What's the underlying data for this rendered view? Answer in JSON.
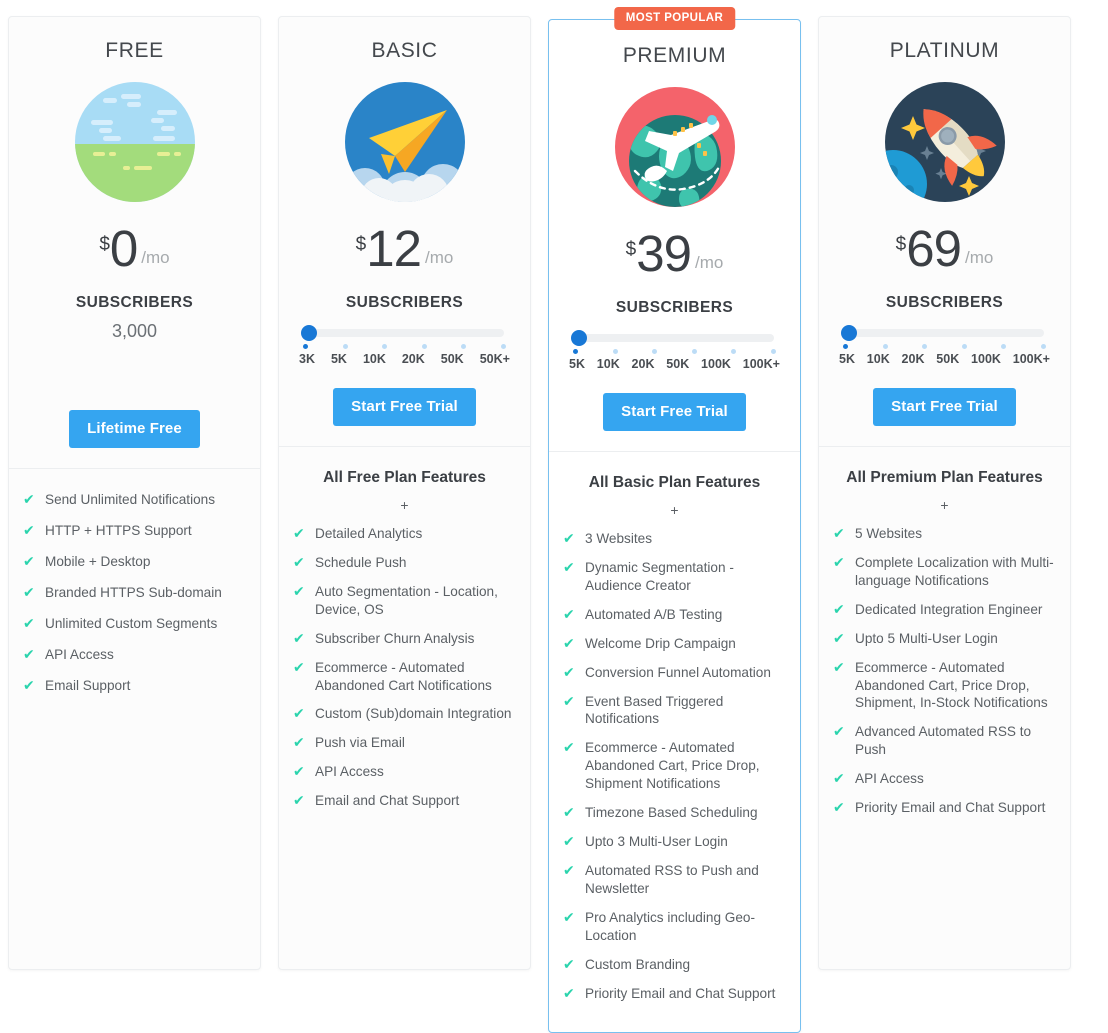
{
  "theme": {
    "accent_blue": "#35a5f0",
    "slider_blue": "#1878d6",
    "badge_orange": "#f26749",
    "check_teal": "#2bd4ad",
    "featured_border": "#78c0ef",
    "card_border": "#eceef0",
    "text_dark": "#3b3f44",
    "text_body": "#5b6065",
    "text_muted": "#a6aaad"
  },
  "labels": {
    "subscribers": "SUBSCRIBERS",
    "per_month": "/mo",
    "currency": "$",
    "plus": "+",
    "badge_most_popular": "MOST POPULAR"
  },
  "plans": [
    {
      "name": "FREE",
      "illustration": "landscape-sky-field-icon",
      "price": "0",
      "currency": "$",
      "period": "/mo",
      "featured": false,
      "badge": null,
      "subscribers_label": "SUBSCRIBERS",
      "subscribers_static": "3,000",
      "has_slider": false,
      "slider_ticks": [],
      "slider_active_index": null,
      "cta_label": "Lifetime Free",
      "features_title": null,
      "features": [
        "Send Unlimited Notifications",
        "HTTP + HTTPS Support",
        "Mobile + Desktop",
        "Branded HTTPS Sub-domain",
        "Unlimited Custom Segments",
        "API Access",
        "Email Support"
      ]
    },
    {
      "name": "BASIC",
      "illustration": "paper-plane-icon",
      "price": "12",
      "currency": "$",
      "period": "/mo",
      "featured": false,
      "badge": null,
      "subscribers_label": "SUBSCRIBERS",
      "subscribers_static": null,
      "has_slider": true,
      "slider_ticks": [
        "3K",
        "5K",
        "10K",
        "20K",
        "50K",
        "50K+"
      ],
      "slider_active_index": 0,
      "cta_label": "Start Free Trial",
      "features_title": "All Free Plan Features",
      "features": [
        "Detailed Analytics",
        "Schedule Push",
        "Auto Segmentation - Location, Device, OS",
        "Subscriber Churn Analysis",
        "Ecommerce - Automated Abandoned Cart Notifications",
        "Custom (Sub)domain Integration",
        "Push via Email",
        "API Access",
        "Email and Chat Support"
      ]
    },
    {
      "name": "PREMIUM",
      "illustration": "airplane-globe-icon",
      "price": "39",
      "currency": "$",
      "period": "/mo",
      "featured": true,
      "badge": "MOST POPULAR",
      "subscribers_label": "SUBSCRIBERS",
      "subscribers_static": null,
      "has_slider": true,
      "slider_ticks": [
        "5K",
        "10K",
        "20K",
        "50K",
        "100K",
        "100K+"
      ],
      "slider_active_index": 0,
      "cta_label": "Start Free Trial",
      "features_title": "All Basic Plan Features",
      "features": [
        "3 Websites",
        "Dynamic Segmentation - Audience Creator",
        "Automated A/B Testing",
        "Welcome Drip Campaign",
        "Conversion Funnel Automation",
        "Event Based Triggered Notifications",
        "Ecommerce - Automated Abandoned Cart, Price Drop, Shipment Notifications",
        "Timezone Based Scheduling",
        "Upto 3 Multi-User Login",
        "Automated RSS to Push and Newsletter",
        "Pro Analytics including Geo-Location",
        "Custom Branding",
        "Priority Email and Chat Support"
      ]
    },
    {
      "name": "PLATINUM",
      "illustration": "rocket-space-icon",
      "price": "69",
      "currency": "$",
      "period": "/mo",
      "featured": false,
      "badge": null,
      "subscribers_label": "SUBSCRIBERS",
      "subscribers_static": null,
      "has_slider": true,
      "slider_ticks": [
        "5K",
        "10K",
        "20K",
        "50K",
        "100K",
        "100K+"
      ],
      "slider_active_index": 0,
      "cta_label": "Start Free Trial",
      "features_title": "All Premium Plan Features",
      "features": [
        "5 Websites",
        "Complete Localization with Multi-language Notifications",
        "Dedicated Integration Engineer",
        "Upto 5 Multi-User Login",
        "Ecommerce - Automated Abandoned Cart, Price Drop, Shipment, In-Stock Notifications",
        "Advanced Automated RSS to Push",
        "API Access",
        "Priority Email and Chat Support"
      ]
    }
  ]
}
